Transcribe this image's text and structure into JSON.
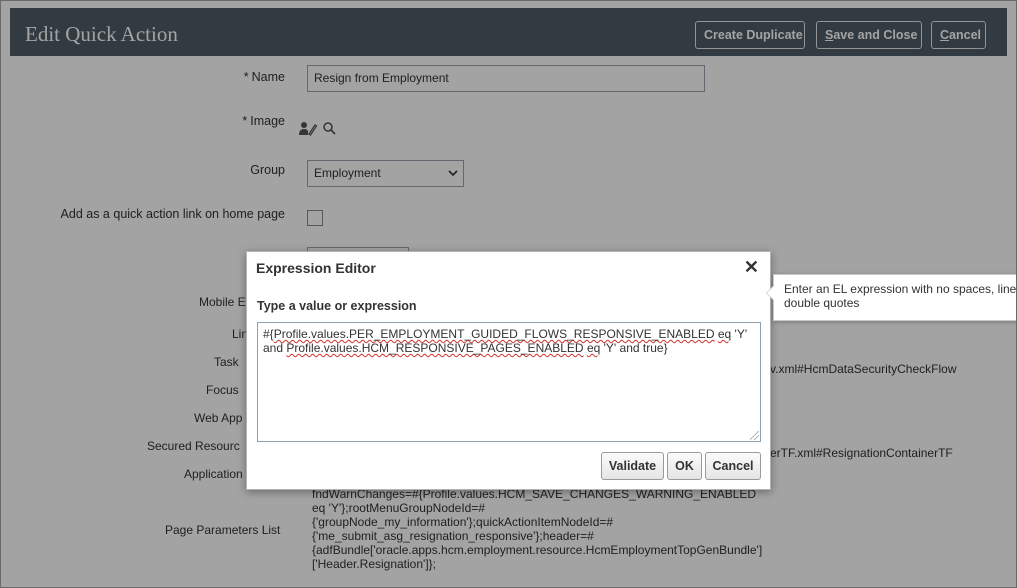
{
  "header": {
    "title": "Edit Quick Action",
    "create_duplicate": "Create Duplicate",
    "save_close_first": "S",
    "save_close_rest": "ave and Close",
    "cancel_first": "C",
    "cancel_rest": "ancel"
  },
  "form": {
    "name_label": "Name",
    "name_value": "Resign from Employment",
    "image_label": "Image",
    "group_label": "Group",
    "group_value": "Employment",
    "home_link_label": "Add as a quick action link on home page",
    "mobile_label_partial": "Mobile E",
    "link_label_partial": "Lin",
    "task_label_partial": "Task",
    "focus_label_partial": "Focus",
    "webapp_label_partial": "Web App",
    "secured_label_partial": "Secured Resourc",
    "application_label_partial": "Application",
    "task_value_partial": "v.xml#HcmDataSecurityCheckFlow",
    "secured_value_partial": "erTF.xml#ResignationContainerTF",
    "page_params_label": "Page Parameters List",
    "page_params_value": "fndWarnChanges=#{Profile.values.HCM_SAVE_CHANGES_WARNING_ENABLED\neq 'Y'};rootMenuGroupNodeId=#\n{'groupNode_my_information'};quickActionItemNodeId=#\n{'me_submit_asg_resignation_responsive'};header=#\n{adfBundle['oracle.apps.hcm.employment.resource.HcmEmploymentTopGenBundle']\n['Header.Resignation']};"
  },
  "dialog": {
    "title": "Expression Editor",
    "close_glyph": "✕",
    "field_label": "Type a value or expression",
    "expr_l1_a": "#{",
    "expr_l1_b": "Profile.values.PER_EMPLOYMENT_GUIDED_FLOWS_RESPONSIVE_ENABLED",
    "expr_l1_c": " ",
    "expr_l1_d": "eq",
    "expr_l1_e": " 'Y'",
    "expr_l2_a": "and ",
    "expr_l2_b": "Profile.values.HCM_RESPONSIVE_PAGES_ENABLED",
    "expr_l2_c": " ",
    "expr_l2_d": "eq",
    "expr_l2_e": " 'Y' and true}",
    "validate": "Validate",
    "ok": "OK",
    "cancel": "Cancel"
  },
  "tooltip": {
    "text": "Enter an EL expression with no spaces, line double quotes"
  },
  "icons": {
    "image_edit": "person-edit-icon",
    "image_search": "magnifier-icon",
    "group_dropdown": "chevron-down-icon",
    "close": "close-icon"
  },
  "colors": {
    "header_bg": "#4f5b68",
    "overlay": "rgba(0,0,0,0.36)",
    "spell_error": "#d0312d"
  }
}
